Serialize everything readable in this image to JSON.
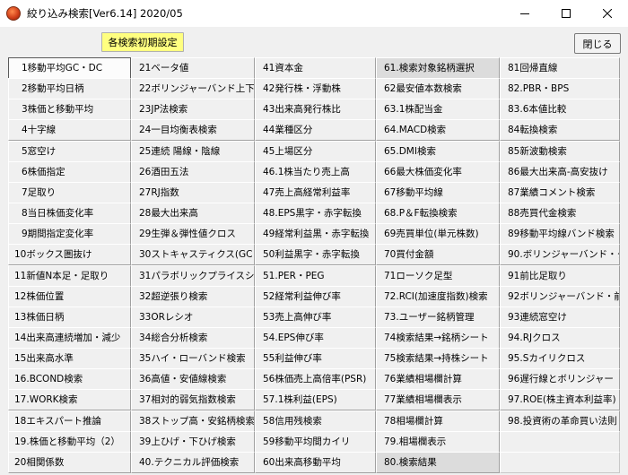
{
  "window": {
    "title": "絞り込み検索[Ver6.14] 2020/05"
  },
  "toolbar": {
    "reset_label": "各検索初期設定",
    "close_label": "閉じる"
  },
  "columns": [
    [
      "1移動平均GC・DC",
      "2移動平均日柄",
      "3株価と移動平均",
      "4十字線",
      "5窓空け",
      "6株価指定",
      "7足取り",
      "8当日株価変化率",
      "9期間指定変化率",
      "10ボックス圏抜け",
      "11新値N本足・足取り",
      "12株価位置",
      "13株価日柄",
      "14出来高連続増加・減少",
      "15出来高水準",
      "16.BCOND検索",
      "17.WORK検索",
      "18エキスパート推論",
      "19.株価と移動平均（2）",
      "20相関係数"
    ],
    [
      "21ベータ値",
      "22ボリンジャーバンド上下抜",
      "23JP法検索",
      "24一目均衡表検索",
      "25連続 陽線・陰線",
      "26酒田五法",
      "27RJ指数",
      "28最大出来高",
      "29生弾＆弾性値クロス",
      "30ストキャスティクス(GC・DC)",
      "31パラボリックプライスシステム",
      "32超逆張り検索",
      "33ORレシオ",
      "34総合分析検索",
      "35ハイ・ローバンド検索",
      "36高値・安値線検索",
      "37相対的弱気指数検索",
      "38ストップ高・安銘柄検索",
      "39上ひげ・下ひげ検索",
      "40.テクニカル評価検索"
    ],
    [
      "41資本金",
      "42発行株・浮動株",
      "43出来高発行株比",
      "44業種区分",
      "45上場区分",
      "46.1株当たり売上高",
      "47売上高経常利益率",
      "48.EPS黒字・赤字転換",
      "49経常利益黒・赤字転換",
      "50利益黒字・赤字転換",
      "51.PER・PEG",
      "52経常利益伸び率",
      "53売上高伸び率",
      "54.EPS伸び率",
      "55利益伸び率",
      "56株価売上高倍率(PSR)",
      "57.1株利益(EPS)",
      "58信用残検索",
      "59移動平均間カイリ",
      "60出来高移動平均"
    ],
    [
      "61.検索対象銘柄選択",
      "62最安値本数検索",
      "63.1株配当金",
      "64.MACD検索",
      "65.DMI検索",
      "66最大株価変化率",
      "67移動平均線",
      "68.P＆F転換検索",
      "69売買単位(単元株数)",
      "70買付金額",
      "71ローソク足型",
      "72.RCI(加速度指数)検索",
      "73.ユーザー銘柄管理",
      "74検索結果→銘柄シート",
      "75検索結果→持株シート",
      "76業績相場欄計算",
      "77業績相場欄表示",
      "78相場欄計算",
      "79.相場欄表示",
      "80.検索結果"
    ],
    [
      "81回帰直線",
      "82.PBR・BPS",
      "83.6本値比較",
      "84転換検索",
      "85新波動検索",
      "86最大出来高-高安抜け",
      "87業績コメント検索",
      "88売買代金検索",
      "89移動平均線バンド検索",
      "90.ボリンジャーバンド・クロス",
      "91前比足取り",
      "92ボリンジャーバンド・前比",
      "93連続窓空け",
      "94.RJクロス",
      "95.Sカイリクロス",
      "96遅行線とボリンジャー",
      "97.ROE(株主資本利益率)",
      "98.投資術の革命買い法則",
      "",
      ""
    ]
  ],
  "selected_label": "1移動平均GC・DC",
  "shaded_labels": [
    "61.検索対象銘柄選択",
    "80.検索結果"
  ]
}
